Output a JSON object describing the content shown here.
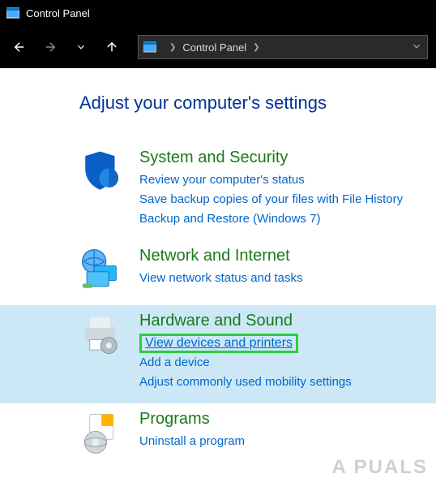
{
  "titlebar": {
    "title": "Control Panel"
  },
  "addressbar": {
    "crumb": "Control Panel"
  },
  "heading": "Adjust your computer's settings",
  "categories": [
    {
      "title": "System and Security",
      "links": [
        "Review your computer's status",
        "Save backup copies of your files with File History",
        "Backup and Restore (Windows 7)"
      ]
    },
    {
      "title": "Network and Internet",
      "links": [
        "View network status and tasks"
      ]
    },
    {
      "title": "Hardware and Sound",
      "links": [
        "View devices and printers",
        "Add a device",
        "Adjust commonly used mobility settings"
      ]
    },
    {
      "title": "Programs",
      "links": [
        "Uninstall a program"
      ]
    }
  ],
  "watermark": "A   PUALS"
}
